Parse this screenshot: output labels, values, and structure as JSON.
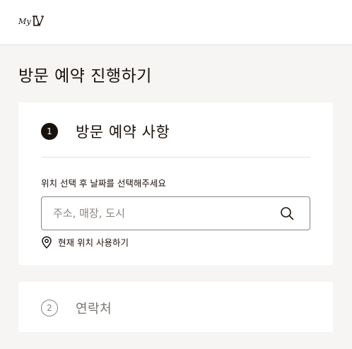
{
  "header": {
    "logo_text": "My",
    "logo_mark": "LV"
  },
  "page": {
    "title": "방문 예약 진행하기"
  },
  "steps": [
    {
      "number": "1",
      "title": "방문 예약 사항",
      "state": "active",
      "field_label": "위치 선택 후 날짜를 선택해주세요",
      "search": {
        "placeholder": "주소, 매장, 도시",
        "value": ""
      },
      "location_link": "현재 위치 사용하기"
    },
    {
      "number": "2",
      "title": "연락처",
      "state": "inactive"
    }
  ],
  "icons": {
    "search": "search-icon",
    "location": "location-pin-icon"
  },
  "colors": {
    "text": "#19110b",
    "background": "#f6f5f3",
    "card": "#ffffff",
    "muted": "#8a8680",
    "divider": "#e1dfdc"
  }
}
